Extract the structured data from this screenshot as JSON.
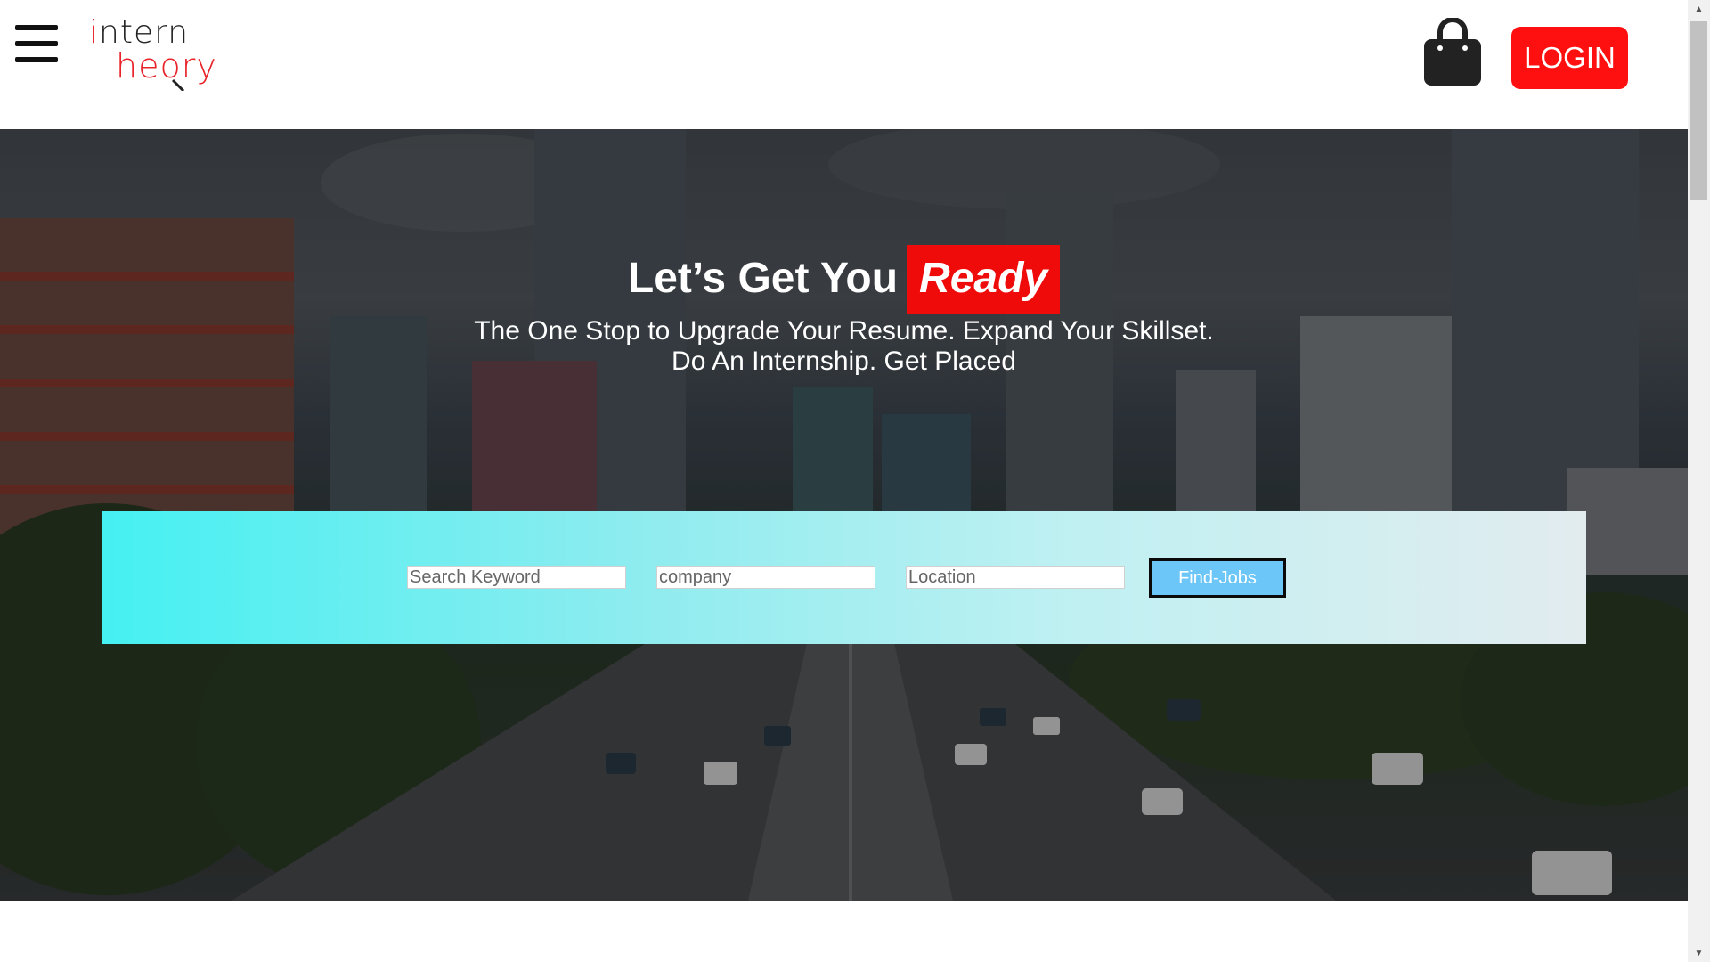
{
  "header": {
    "logo": {
      "line1_first": "i",
      "line1_rest": "ntern",
      "line2": "heory"
    },
    "login_label": "LOGIN"
  },
  "hero": {
    "title_main": "Let’s Get You",
    "title_highlight": "Ready",
    "subtitle_line1": "The One Stop to Upgrade Your Resume. Expand Your Skillset.",
    "subtitle_line2": "Do An Internship. Get Placed"
  },
  "search": {
    "keyword_placeholder": "Search Keyword",
    "company_placeholder": "company",
    "location_placeholder": "Location",
    "find_label": "Find-Jobs"
  },
  "icons": {
    "menu": "hamburger-menu-icon",
    "cart": "shopping-bag-icon"
  },
  "colors": {
    "brand_red": "#ff1010",
    "panel_start": "#45f0f2",
    "panel_end": "#e2ecef",
    "find_button": "#6cc6f8"
  }
}
